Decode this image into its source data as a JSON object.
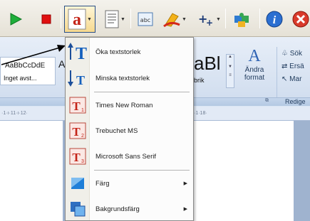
{
  "toolbar": {
    "buttons": [
      "play-icon",
      "stop-icon",
      "font-dropdown-icon",
      "document-dropdown-icon",
      "abc-icon",
      "highlight-dropdown-icon",
      "add-dropdown-icon",
      "puzzle-icon",
      "info-icon",
      "close-icon"
    ]
  },
  "ribbon": {
    "style_sample": "AaBbCcDdE",
    "style_name": "Inget avst...",
    "style_sample2": "A",
    "big_sample": "aBl",
    "brik_label": "brik",
    "change_format_label_1": "Ändra",
    "change_format_label_2": "format",
    "find_label": "Sök",
    "replace_label": "Ersä",
    "mark_label": "Mar",
    "edit_group_label": "Redige",
    "ruler_left": "·1·ı·11·ı·12·",
    "ruler_right": "·1·18·"
  },
  "menu": {
    "items": [
      {
        "label": "Öka textstorlek",
        "icon": "increase-text-size-icon"
      },
      {
        "label": "Minska textstorlek",
        "icon": "decrease-text-size-icon"
      },
      {
        "label": "Times New Roman",
        "icon": "font-1-icon",
        "badge": "1"
      },
      {
        "label": "Trebuchet MS",
        "icon": "font-2-icon",
        "badge": "2"
      },
      {
        "label": "Microsoft Sans Serif",
        "icon": "font-3-icon",
        "badge": "3"
      },
      {
        "label": "Färg",
        "icon": "color-icon",
        "has_sub": true
      },
      {
        "label": "Bakgrundsfärg",
        "icon": "background-color-icon",
        "has_sub": true
      }
    ],
    "submenu_arrow": "▶",
    "big_letter": "T"
  },
  "colors": {
    "accent_red": "#d42a1a",
    "play_green": "#1fae3a",
    "menu_blue": "#1560bd"
  }
}
